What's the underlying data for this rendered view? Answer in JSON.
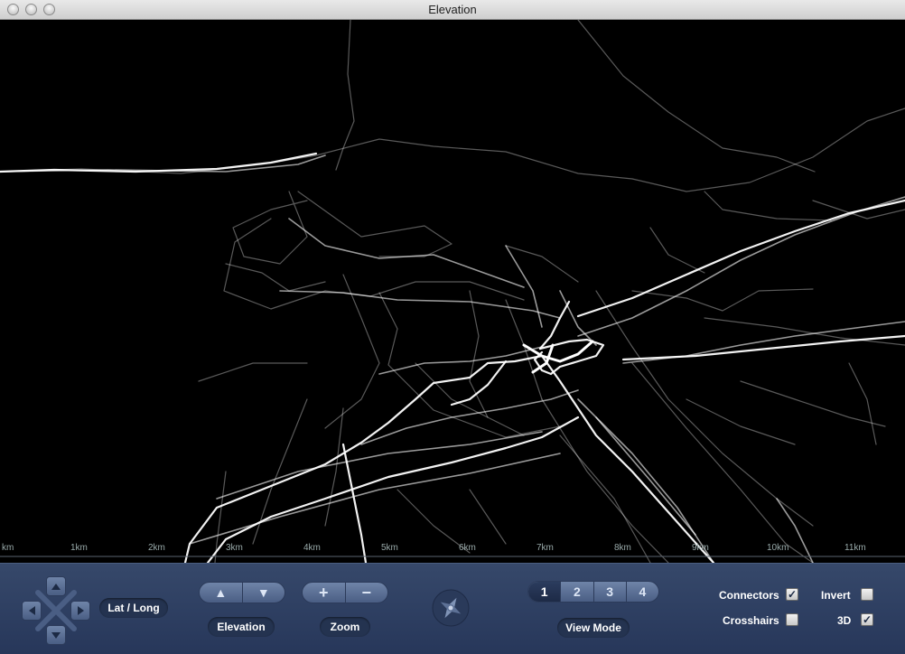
{
  "window": {
    "title": "Elevation"
  },
  "map": {
    "scale_labels": [
      "km",
      "1km",
      "2km",
      "3km",
      "4km",
      "5km",
      "6km",
      "7km",
      "8km",
      "9km",
      "10km",
      "11km"
    ]
  },
  "controls": {
    "latlong_label": "Lat / Long",
    "elevation_label": "Elevation",
    "elevation_up": "▲",
    "elevation_down": "▼",
    "zoom_label": "Zoom",
    "zoom_in": "+",
    "zoom_out": "−",
    "view_mode_label": "View Mode",
    "view_modes": [
      "1",
      "2",
      "3",
      "4"
    ],
    "active_view_mode": "1",
    "checkboxes": {
      "connectors": {
        "label": "Connectors",
        "checked": true
      },
      "invert": {
        "label": "Invert",
        "checked": false
      },
      "crosshairs": {
        "label": "Crosshairs",
        "checked": false
      },
      "three_d": {
        "label": "3D",
        "checked": true
      }
    }
  },
  "colors": {
    "panel": "#2f4064",
    "map_background": "#000000",
    "trace": "#ffffff"
  }
}
